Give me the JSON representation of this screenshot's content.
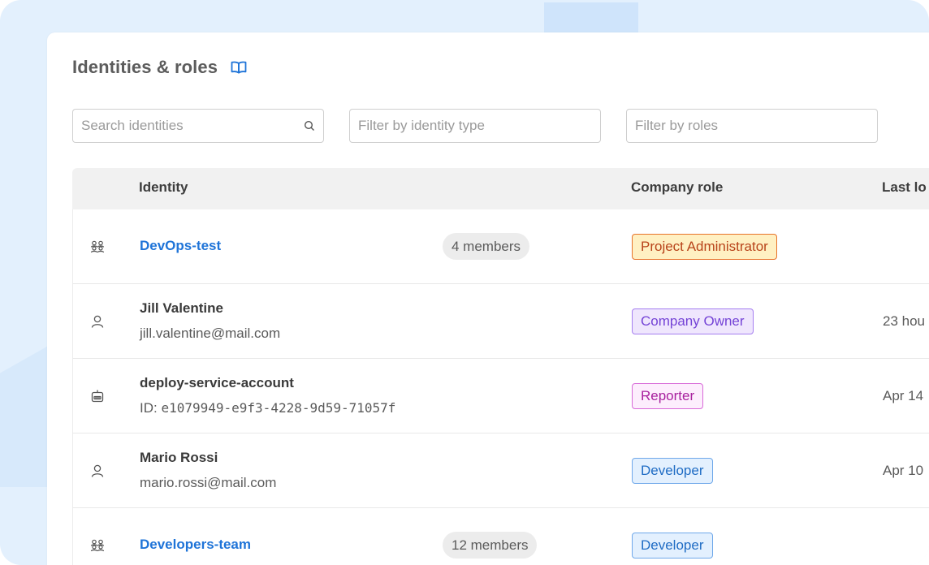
{
  "page": {
    "title": "Identities & roles",
    "docs_icon": "book-open-icon"
  },
  "filters": {
    "search_placeholder": "Search identities",
    "identity_type_placeholder": "Filter by identity type",
    "roles_placeholder": "Filter by roles"
  },
  "table": {
    "headers": {
      "identity": "Identity",
      "company_role": "Company role",
      "last_login": "Last lo"
    },
    "rows": [
      {
        "type_icon": "group-icon",
        "name": "DevOps-test",
        "is_link": true,
        "subtitle": "",
        "members": "4 members",
        "role": "Project Administrator",
        "role_style": "admin",
        "last_login": ""
      },
      {
        "type_icon": "user-icon",
        "name": "Jill Valentine",
        "is_link": false,
        "subtitle": "jill.valentine@mail.com",
        "members": "",
        "role": "Company Owner",
        "role_style": "owner",
        "last_login": "23 hou"
      },
      {
        "type_icon": "robot-icon",
        "name": "deploy-service-account",
        "is_link": false,
        "subtitle_prefix": "ID: ",
        "subtitle_mono": "e1079949-e9f3-4228-9d59-71057f",
        "members": "",
        "role": "Reporter",
        "role_style": "reporter",
        "last_login": "Apr 14"
      },
      {
        "type_icon": "user-icon",
        "name": "Mario Rossi",
        "is_link": false,
        "subtitle": "mario.rossi@mail.com",
        "members": "",
        "role": "Developer",
        "role_style": "dev",
        "last_login": "Apr 10"
      },
      {
        "type_icon": "group-icon",
        "name": "Developers-team",
        "is_link": true,
        "subtitle": "",
        "members": "12 members",
        "role": "Developer",
        "role_style": "dev",
        "last_login": ""
      }
    ]
  },
  "colors": {
    "link": "#1f74d8",
    "frame_bg": "#e3f0fd",
    "header_bg": "#f1f1f1"
  }
}
